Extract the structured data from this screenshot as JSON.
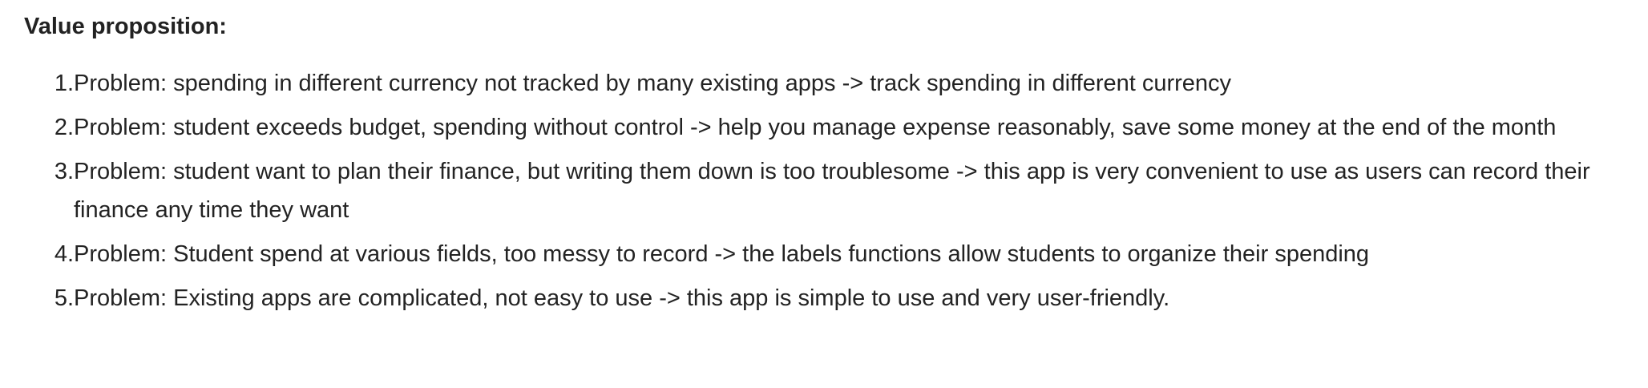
{
  "document": {
    "heading": "Value proposition:",
    "items": [
      {
        "number": "1.",
        "text": "Problem: spending in different currency not tracked by many existing apps -> track spending in different currency"
      },
      {
        "number": "2.",
        "text": "Problem: student exceeds budget, spending without control -> help you manage expense reasonably, save some money at the end of the month"
      },
      {
        "number": "3.",
        "text": "Problem: student want to plan their finance, but writing them down is too troublesome -> this app is very convenient to use as users can record their finance any time they want"
      },
      {
        "number": "4.",
        "text": "Problem: Student spend at various fields, too messy to record -> the labels functions allow students to organize their spending"
      },
      {
        "number": "5.",
        "text": "Problem: Existing apps are complicated, not easy to use -> this app is simple to use and very user-friendly."
      }
    ]
  }
}
